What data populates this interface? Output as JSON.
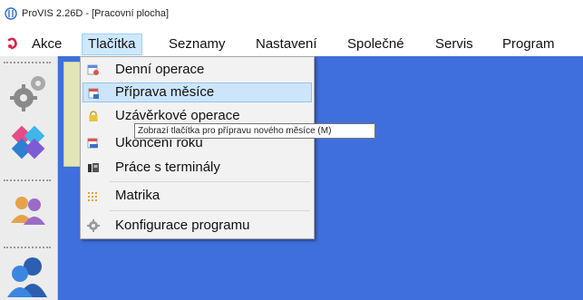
{
  "window": {
    "title": "ProVIS 2.26D - [Pracovní plocha]"
  },
  "menubar": {
    "items": [
      {
        "label": "Akce"
      },
      {
        "label": "Tlačítka"
      },
      {
        "label": "Seznamy"
      },
      {
        "label": "Nastavení"
      },
      {
        "label": "Společné"
      },
      {
        "label": "Servis"
      },
      {
        "label": "Program"
      }
    ],
    "active_index": 1
  },
  "dropdown": {
    "items": [
      {
        "label": "Denní operace",
        "icon": "calendar-clock-icon"
      },
      {
        "label": "Příprava měsíce",
        "icon": "calendar-month-icon"
      },
      {
        "label": "Uzávěrkové operace",
        "icon": "lock-icon"
      },
      {
        "label": "Ukončení roku",
        "icon": "calendar-year-icon"
      },
      {
        "label": "Práce s terminály",
        "icon": "terminal-icon"
      },
      {
        "label": "Matrika",
        "icon": "matrix-icon"
      },
      {
        "label": "Konfigurace programu",
        "icon": "gear-icon"
      }
    ],
    "highlighted_index": 1
  },
  "tooltip": {
    "text": "Zobrazí tlačítka pro přípravu nového měsíce (M)"
  },
  "colors": {
    "workspace_bg": "#3f6fdc",
    "highlight": "#cce5fb",
    "menu_active": "#cde8ff"
  }
}
